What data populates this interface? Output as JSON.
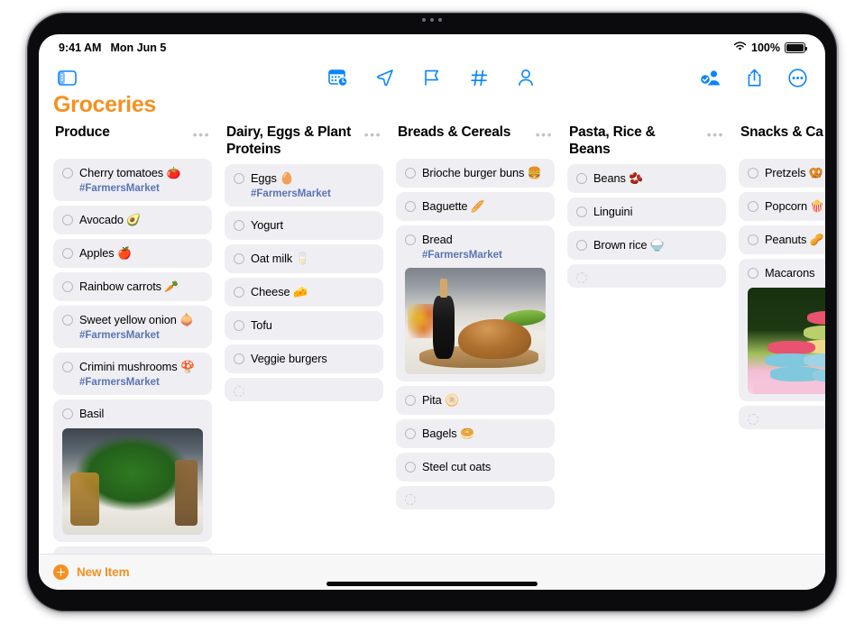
{
  "status_bar": {
    "time": "9:41 AM",
    "date": "Mon Jun 5",
    "battery_percent": "100%",
    "wifi_icon": "wifi-icon",
    "battery_icon": "battery-icon"
  },
  "toolbar": {
    "sidebar_toggle": "sidebar-toggle-icon",
    "center_items": [
      {
        "name": "date-icon",
        "label": "Date"
      },
      {
        "name": "location-icon",
        "label": "Location"
      },
      {
        "name": "flag-icon",
        "label": "Flag"
      },
      {
        "name": "tag-icon",
        "label": "Tag"
      },
      {
        "name": "person-icon",
        "label": "Mention"
      }
    ],
    "right_items": [
      {
        "name": "collaborate-icon",
        "label": "Collaborate"
      },
      {
        "name": "share-icon",
        "label": "Share"
      },
      {
        "name": "more-icon",
        "label": "More"
      }
    ]
  },
  "document": {
    "title": "Groceries",
    "title_color": "#F5901F"
  },
  "board": {
    "more_glyph": "•••",
    "columns": [
      {
        "title": "Produce",
        "items": [
          {
            "text": "Cherry tomatoes 🍅",
            "tag": "#FarmersMarket"
          },
          {
            "text": "Avocado 🥑"
          },
          {
            "text": "Apples 🍎"
          },
          {
            "text": "Rainbow carrots 🥕"
          },
          {
            "text": "Sweet yellow onion 🧅",
            "tag": "#FarmersMarket"
          },
          {
            "text": "Crimini mushrooms 🍄",
            "tag": "#FarmersMarket"
          },
          {
            "text": "Basil",
            "photo": "basil"
          },
          {
            "text": "",
            "empty": true
          }
        ]
      },
      {
        "title": "Dairy, Eggs & Plant Proteins",
        "items": [
          {
            "text": "Eggs 🥚",
            "tag": "#FarmersMarket"
          },
          {
            "text": "Yogurt"
          },
          {
            "text": "Oat milk 🥛"
          },
          {
            "text": "Cheese 🧀"
          },
          {
            "text": "Tofu"
          },
          {
            "text": "Veggie burgers"
          },
          {
            "text": "",
            "empty": true
          }
        ]
      },
      {
        "title": "Breads & Cereals",
        "items": [
          {
            "text": "Brioche burger buns 🍔"
          },
          {
            "text": "Baguette 🥖"
          },
          {
            "text": "Bread",
            "tag": "#FarmersMarket",
            "photo": "bread"
          },
          {
            "text": "Pita 🫓"
          },
          {
            "text": "Bagels 🥯"
          },
          {
            "text": "Steel cut oats"
          },
          {
            "text": "",
            "empty": true
          }
        ]
      },
      {
        "title": "Pasta, Rice & Beans",
        "items": [
          {
            "text": "Beans 🫘"
          },
          {
            "text": "Linguini"
          },
          {
            "text": "Brown rice 🍚"
          },
          {
            "text": "",
            "empty": true
          }
        ]
      },
      {
        "title": "Snacks & Ca",
        "items": [
          {
            "text": "Pretzels 🥨"
          },
          {
            "text": "Popcorn 🍿"
          },
          {
            "text": "Peanuts 🥜"
          },
          {
            "text": "Macarons",
            "photo": "macaron"
          },
          {
            "text": "",
            "empty": true
          }
        ]
      }
    ]
  },
  "bottom_bar": {
    "new_item_label": "New Item",
    "plus_icon": "plus-circle-icon",
    "accent_color": "#F5901F"
  }
}
